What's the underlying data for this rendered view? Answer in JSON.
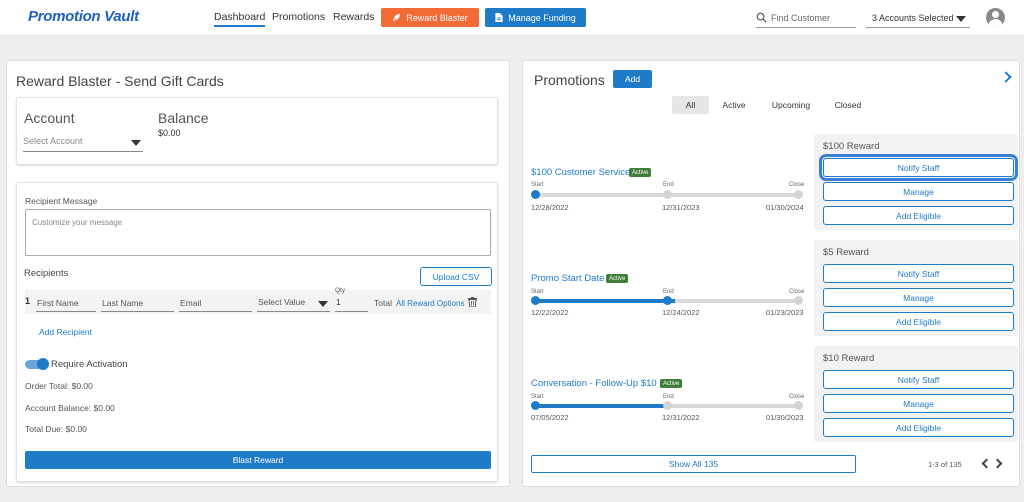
{
  "app": {
    "logo": "Promotion Vault"
  },
  "nav": {
    "dashboard": "Dashboard",
    "promotions": "Promotions",
    "rewards": "Rewards",
    "reward_blaster_btn": "Reward Blaster",
    "manage_funding_btn": "Manage Funding",
    "search_placeholder": "Find Customer",
    "accounts_selected": "3 Accounts Selected"
  },
  "blaster": {
    "title": "Reward Blaster - Send Gift Cards",
    "account_label": "Account",
    "select_account": "Select Account",
    "balance_label": "Balance",
    "balance_value": "$0.00",
    "recipient_message_label": "Recipient Message",
    "message_placeholder": "Customize your message",
    "recipients_label": "Recipients",
    "upload_csv": "Upload CSV",
    "row_number": "1",
    "first_name": "First Name",
    "last_name": "Last Name",
    "email": "Email",
    "select_value": "Select Value",
    "qty_label": "Qty",
    "qty_value": "1",
    "total_label": "Total",
    "all_reward_options": "All Reward Options",
    "add_recipient": "Add Recipient",
    "require_activation": "Require Activation",
    "order_total": "Order Total: $0.00",
    "account_balance": "Account Balance: $0.00",
    "total_due": "Total Due: $0.00",
    "blast_reward": "Blast Reward"
  },
  "promotions": {
    "title": "Promotions",
    "add_btn": "Add",
    "tabs": [
      "All",
      "Active",
      "Upcoming",
      "Closed"
    ],
    "timeline_labels": {
      "start": "Start",
      "end": "End",
      "close": "Close"
    },
    "items": [
      {
        "name": "$100 Customer Service",
        "status": "Active",
        "start": "12/28/2022",
        "end": "12/31/2023",
        "close": "01/30/2024",
        "progress": 0,
        "reward": "$100 Reward"
      },
      {
        "name": "Promo Start Date",
        "status": "Active",
        "start": "12/22/2022",
        "end": "12/24/2022",
        "close": "01/23/2023",
        "progress": 0.53,
        "reward": "$5 Reward"
      },
      {
        "name": "Conversation - Follow-Up $10",
        "status": "Active",
        "start": "07/05/2022",
        "end": "12/31/2022",
        "close": "01/30/2023",
        "progress": 0.5,
        "reward": "$10 Reward"
      }
    ],
    "reward_actions": {
      "notify": "Notify Staff",
      "manage": "Manage",
      "add_eligible": "Add Eligible"
    },
    "show_all": "Show All 135",
    "pagination": "1-3 of 135"
  },
  "colors": {
    "accent": "#1f7ac8",
    "orange": "#f26a36",
    "active_badge": "#3f7d3a"
  }
}
